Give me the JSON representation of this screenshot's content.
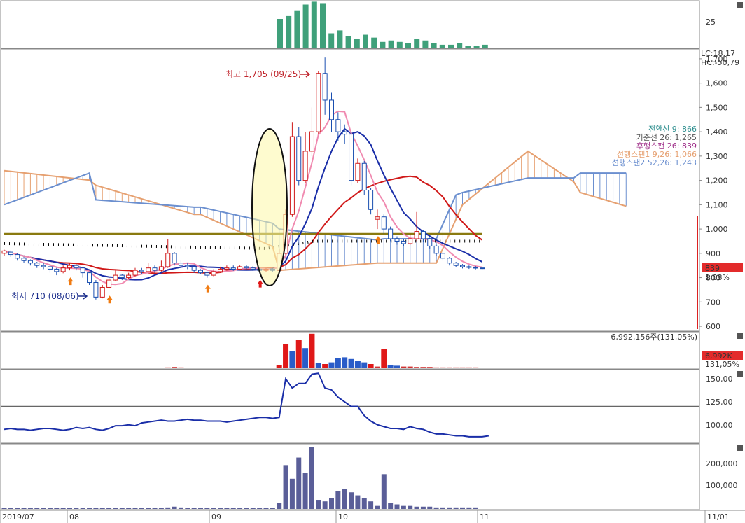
{
  "chart_data": {
    "type": "candlestick",
    "price_ticks": [
      "1,700",
      "1,600",
      "1,500",
      "1,400",
      "1,300",
      "1,200",
      "1,100",
      "1,000",
      "900",
      "800",
      "700",
      "600"
    ],
    "top_tick": "25",
    "volume_summary": "6,992,156주(131,05%)",
    "volume_badge": "6,992K",
    "volume_pct": "131,05%",
    "osc_ticks": [
      "150,00",
      "125,00",
      "100,00"
    ],
    "bottom_ticks": [
      "200,000",
      "100,000"
    ],
    "price_badge": "839",
    "price_badge_pct": "1,08%",
    "lc_label": "LC:18,17",
    "hc_label": "HC:-50,79",
    "x_labels": [
      "2019/07",
      "08",
      "09",
      "10",
      "11",
      "11/01"
    ],
    "annotations": {
      "high": "최고 1,705 (09/25)",
      "low": "최저 710 (08/06)"
    },
    "legend": [
      {
        "text": "전환선 9: 866",
        "color": "#2f8f8f"
      },
      {
        "text": "기준선 26: 1,265",
        "color": "#555555"
      },
      {
        "text": "후행스팬 26: 839",
        "color": "#a0308a"
      },
      {
        "text": "선행스팬1 9,26: 1,066",
        "color": "#e6a070"
      },
      {
        "text": "선행스팬2 52,26: 1,243",
        "color": "#6b8fcf"
      }
    ],
    "ylim": [
      580,
      1740
    ],
    "candles": [
      {
        "o": 900,
        "c": 910,
        "h": 915,
        "l": 890
      },
      {
        "o": 905,
        "c": 895,
        "h": 912,
        "l": 885
      },
      {
        "o": 895,
        "c": 880,
        "h": 900,
        "l": 870
      },
      {
        "o": 880,
        "c": 870,
        "h": 885,
        "l": 860
      },
      {
        "o": 870,
        "c": 860,
        "h": 875,
        "l": 850
      },
      {
        "o": 860,
        "c": 850,
        "h": 865,
        "l": 840
      },
      {
        "o": 850,
        "c": 845,
        "h": 860,
        "l": 835
      },
      {
        "o": 845,
        "c": 835,
        "h": 850,
        "l": 820
      },
      {
        "o": 835,
        "c": 825,
        "h": 840,
        "l": 810
      },
      {
        "o": 825,
        "c": 840,
        "h": 850,
        "l": 818
      },
      {
        "o": 840,
        "c": 850,
        "h": 860,
        "l": 830
      },
      {
        "o": 850,
        "c": 840,
        "h": 855,
        "l": 830
      },
      {
        "o": 840,
        "c": 820,
        "h": 845,
        "l": 800
      },
      {
        "o": 820,
        "c": 780,
        "h": 825,
        "l": 770
      },
      {
        "o": 780,
        "c": 720,
        "h": 790,
        "l": 710
      },
      {
        "o": 720,
        "c": 760,
        "h": 770,
        "l": 715
      },
      {
        "o": 760,
        "c": 790,
        "h": 800,
        "l": 755
      },
      {
        "o": 790,
        "c": 810,
        "h": 830,
        "l": 785
      },
      {
        "o": 810,
        "c": 800,
        "h": 815,
        "l": 790
      },
      {
        "o": 800,
        "c": 810,
        "h": 820,
        "l": 795
      },
      {
        "o": 810,
        "c": 830,
        "h": 840,
        "l": 805
      },
      {
        "o": 830,
        "c": 825,
        "h": 840,
        "l": 815
      },
      {
        "o": 825,
        "c": 840,
        "h": 860,
        "l": 820
      },
      {
        "o": 840,
        "c": 830,
        "h": 850,
        "l": 820
      },
      {
        "o": 830,
        "c": 845,
        "h": 870,
        "l": 825
      },
      {
        "o": 845,
        "c": 900,
        "h": 960,
        "l": 840
      },
      {
        "o": 900,
        "c": 860,
        "h": 905,
        "l": 850
      },
      {
        "o": 860,
        "c": 850,
        "h": 870,
        "l": 840
      },
      {
        "o": 850,
        "c": 845,
        "h": 860,
        "l": 835
      },
      {
        "o": 845,
        "c": 830,
        "h": 850,
        "l": 820
      },
      {
        "o": 830,
        "c": 820,
        "h": 835,
        "l": 815
      },
      {
        "o": 820,
        "c": 810,
        "h": 825,
        "l": 800
      },
      {
        "o": 810,
        "c": 825,
        "h": 835,
        "l": 805
      },
      {
        "o": 825,
        "c": 835,
        "h": 845,
        "l": 820
      },
      {
        "o": 835,
        "c": 840,
        "h": 850,
        "l": 830
      },
      {
        "o": 840,
        "c": 835,
        "h": 850,
        "l": 828
      },
      {
        "o": 835,
        "c": 845,
        "h": 850,
        "l": 830
      },
      {
        "o": 845,
        "c": 840,
        "h": 852,
        "l": 832
      },
      {
        "o": 840,
        "c": 835,
        "h": 848,
        "l": 828
      },
      {
        "o": 835,
        "c": 830,
        "h": 842,
        "l": 825
      },
      {
        "o": 830,
        "c": 835,
        "h": 840,
        "l": 822
      },
      {
        "o": 835,
        "c": 830,
        "h": 840,
        "l": 825
      },
      {
        "o": 830,
        "c": 900,
        "h": 920,
        "l": 825
      },
      {
        "o": 900,
        "c": 1060,
        "h": 1080,
        "l": 895
      },
      {
        "o": 1060,
        "c": 1380,
        "h": 1440,
        "l": 1050
      },
      {
        "o": 1380,
        "c": 1200,
        "h": 1420,
        "l": 1180
      },
      {
        "o": 1200,
        "c": 1320,
        "h": 1400,
        "l": 1190
      },
      {
        "o": 1320,
        "c": 1400,
        "h": 1500,
        "l": 1300
      },
      {
        "o": 1400,
        "c": 1640,
        "h": 1650,
        "l": 1390
      },
      {
        "o": 1640,
        "c": 1530,
        "h": 1705,
        "l": 1470
      },
      {
        "o": 1530,
        "c": 1450,
        "h": 1560,
        "l": 1400
      },
      {
        "o": 1450,
        "c": 1400,
        "h": 1480,
        "l": 1360
      },
      {
        "o": 1400,
        "c": 1390,
        "h": 1430,
        "l": 1350
      },
      {
        "o": 1390,
        "c": 1200,
        "h": 1400,
        "l": 1180
      },
      {
        "o": 1200,
        "c": 1270,
        "h": 1290,
        "l": 1190
      },
      {
        "o": 1270,
        "c": 1160,
        "h": 1280,
        "l": 1140
      },
      {
        "o": 1160,
        "c": 1080,
        "h": 1170,
        "l": 1060
      },
      {
        "o": 1040,
        "c": 1050,
        "h": 1080,
        "l": 1000
      },
      {
        "o": 1050,
        "c": 1000,
        "h": 1060,
        "l": 980
      },
      {
        "o": 1000,
        "c": 960,
        "h": 1010,
        "l": 950
      },
      {
        "o": 960,
        "c": 950,
        "h": 970,
        "l": 935
      },
      {
        "o": 950,
        "c": 940,
        "h": 960,
        "l": 930
      },
      {
        "o": 940,
        "c": 960,
        "h": 980,
        "l": 935
      },
      {
        "o": 960,
        "c": 990,
        "h": 1070,
        "l": 950
      },
      {
        "o": 990,
        "c": 960,
        "h": 995,
        "l": 945
      },
      {
        "o": 960,
        "c": 930,
        "h": 965,
        "l": 920
      },
      {
        "o": 930,
        "c": 900,
        "h": 935,
        "l": 890
      },
      {
        "o": 900,
        "c": 880,
        "h": 905,
        "l": 870
      },
      {
        "o": 880,
        "c": 860,
        "h": 885,
        "l": 850
      },
      {
        "o": 860,
        "c": 850,
        "h": 865,
        "l": 842
      },
      {
        "o": 850,
        "c": 845,
        "h": 856,
        "l": 838
      },
      {
        "o": 845,
        "c": 842,
        "h": 850,
        "l": 836
      },
      {
        "o": 842,
        "c": 840,
        "h": 848,
        "l": 834
      },
      {
        "o": 840,
        "c": 839,
        "h": 846,
        "l": 832
      }
    ],
    "top_bars": [
      20,
      22,
      26,
      30,
      32,
      31,
      10,
      12,
      8,
      6,
      9,
      7,
      4,
      5,
      4,
      3,
      6,
      5,
      3,
      2,
      2,
      3,
      1,
      1,
      2
    ],
    "volume": [
      1,
      1,
      1,
      1,
      1,
      1,
      1,
      1,
      1,
      1,
      1,
      1,
      1,
      1,
      1,
      1,
      1,
      1,
      1,
      1,
      1,
      1,
      1,
      1,
      1,
      2,
      3,
      2,
      1,
      1,
      1,
      1,
      1,
      1,
      1,
      1,
      1,
      1,
      1,
      1,
      1,
      1,
      8,
      58,
      40,
      68,
      48,
      82,
      12,
      10,
      14,
      24,
      26,
      22,
      18,
      14,
      10,
      4,
      46,
      8,
      6,
      4,
      4,
      3,
      3,
      3,
      2,
      2,
      2,
      2,
      2,
      2,
      2
    ],
    "oscillator": [
      95,
      96,
      95,
      95,
      94,
      95,
      96,
      96,
      95,
      94,
      95,
      97,
      96,
      97,
      95,
      94,
      96,
      99,
      99,
      100,
      99,
      102,
      103,
      104,
      105,
      104,
      104,
      105,
      106,
      105,
      105,
      104,
      104,
      104,
      103,
      104,
      105,
      106,
      107,
      108,
      108,
      107,
      108,
      150,
      140,
      145,
      145,
      155,
      156,
      140,
      138,
      130,
      125,
      120,
      120,
      110,
      104,
      100,
      98,
      96,
      96,
      95,
      98,
      96,
      95,
      92,
      90,
      90,
      89,
      88,
      88,
      87,
      87,
      87,
      88
    ],
    "bottom_bars": [
      1,
      1,
      1,
      1,
      1,
      1,
      1,
      1,
      1,
      1,
      1,
      1,
      1,
      1,
      1,
      1,
      1,
      1,
      1,
      1,
      1,
      1,
      1,
      1,
      1,
      2,
      3,
      2,
      1,
      1,
      1,
      1,
      1,
      1,
      1,
      1,
      1,
      1,
      1,
      1,
      1,
      1,
      8,
      58,
      40,
      68,
      48,
      82,
      12,
      10,
      14,
      24,
      26,
      22,
      18,
      14,
      10,
      4,
      46,
      8,
      6,
      4,
      4,
      3,
      3,
      3,
      2,
      2,
      2,
      2,
      2,
      2,
      2
    ]
  }
}
